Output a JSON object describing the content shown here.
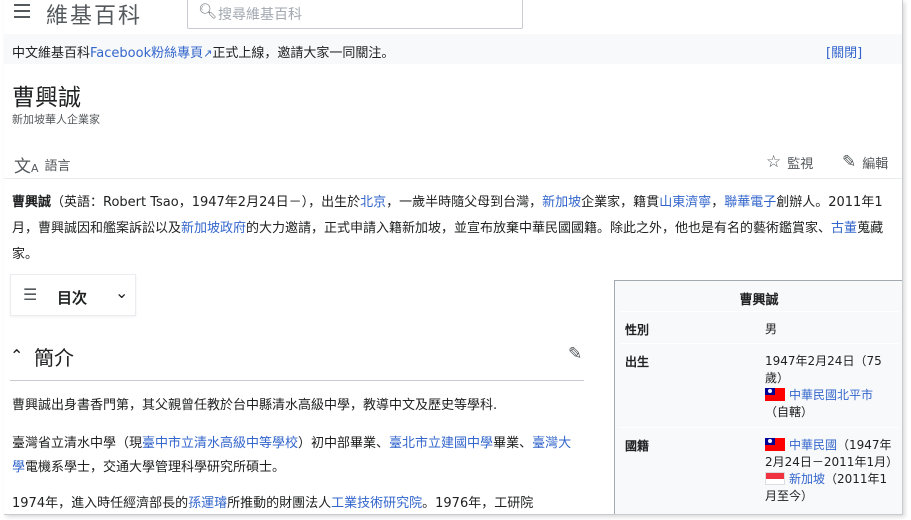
{
  "header": {
    "site_name": "維基百科",
    "search_placeholder": "搜尋維基百科"
  },
  "notice": {
    "text_prefix": "中文維基百科",
    "link": "Facebook粉絲專頁",
    "text_suffix": "正式上線，邀請大家一同關注。",
    "close_label": "[關閉]"
  },
  "article": {
    "title": "曹興誠",
    "subtitle": "新加坡華人企業家",
    "languages_label": "語言",
    "watch_label": "監視",
    "edit_label": "編輯"
  },
  "lead": {
    "s1": "曹興誠",
    "s2": "（英語：Robert Tsao，1947年2月24日－），出生於",
    "l1": "北京",
    "s3": "，一歲半時隨父母到台灣，",
    "l2": "新加坡",
    "s4": "企業家，籍貫",
    "l3": "山東濟寧",
    "s5": "，",
    "l4": "聯華電子",
    "s6": "創辦人。2011年1月，曹興誠因和艦案訴訟以及",
    "l5": "新加坡政府",
    "s7": "的大力邀請，正式申請入籍新加坡，並宣布放棄中華民國國籍。除此之外，他也是有名的藝術鑑賞家、",
    "l6": "古董",
    "s8": "蒐藏家。"
  },
  "toc": {
    "label": "目次"
  },
  "section": {
    "heading": "簡介",
    "p1": "曹興誠出身書香門第，其父親曾任教於台中縣清水高級中學，教導中文及歷史等學科.",
    "p2_s1": "臺灣省立清水中學（現",
    "p2_l1": "臺中市立清水高級中等學校",
    "p2_s2": "）初中部畢業、",
    "p2_l2": "臺北市立建國中學",
    "p2_s3": "畢業、",
    "p2_l3": "臺灣大學",
    "p2_s4": "電機系學士，交通大學管理科學研究所碩士。",
    "p3_s1": "1974年，進入時任經濟部長的",
    "p3_l1": "孫運璿",
    "p3_s2": "所推動的財團法人",
    "p3_l2": "工業技術研究院",
    "p3_s3": "。1976年，工研院"
  },
  "infobox": {
    "title": "曹興誠",
    "gender_label": "性別",
    "gender_value": "男",
    "birth_label": "出生",
    "birth_date": "1947年2月24日（75歲）",
    "birth_place": "中華民國北平市",
    "birth_note": "（自轄）",
    "nationality_label": "國籍",
    "nat1_link": "中華民國",
    "nat1_period": "（1947年2月24日－2011年1月）",
    "nat2_link": "新加坡",
    "nat2_period": "（2011年1月至今）"
  },
  "icons": {
    "menu": "hamburger-icon",
    "search": "search-icon",
    "language": "language-icon",
    "watch": "star-icon",
    "edit": "pencil-icon",
    "toc": "list-icon",
    "toc_toggle": "chevron-down-icon",
    "section_toggle": "chevron-up-icon"
  },
  "colors": {
    "link": "#3366cc",
    "text": "#202122",
    "muted": "#54595d",
    "infobox_bg": "#f8f9fa"
  }
}
